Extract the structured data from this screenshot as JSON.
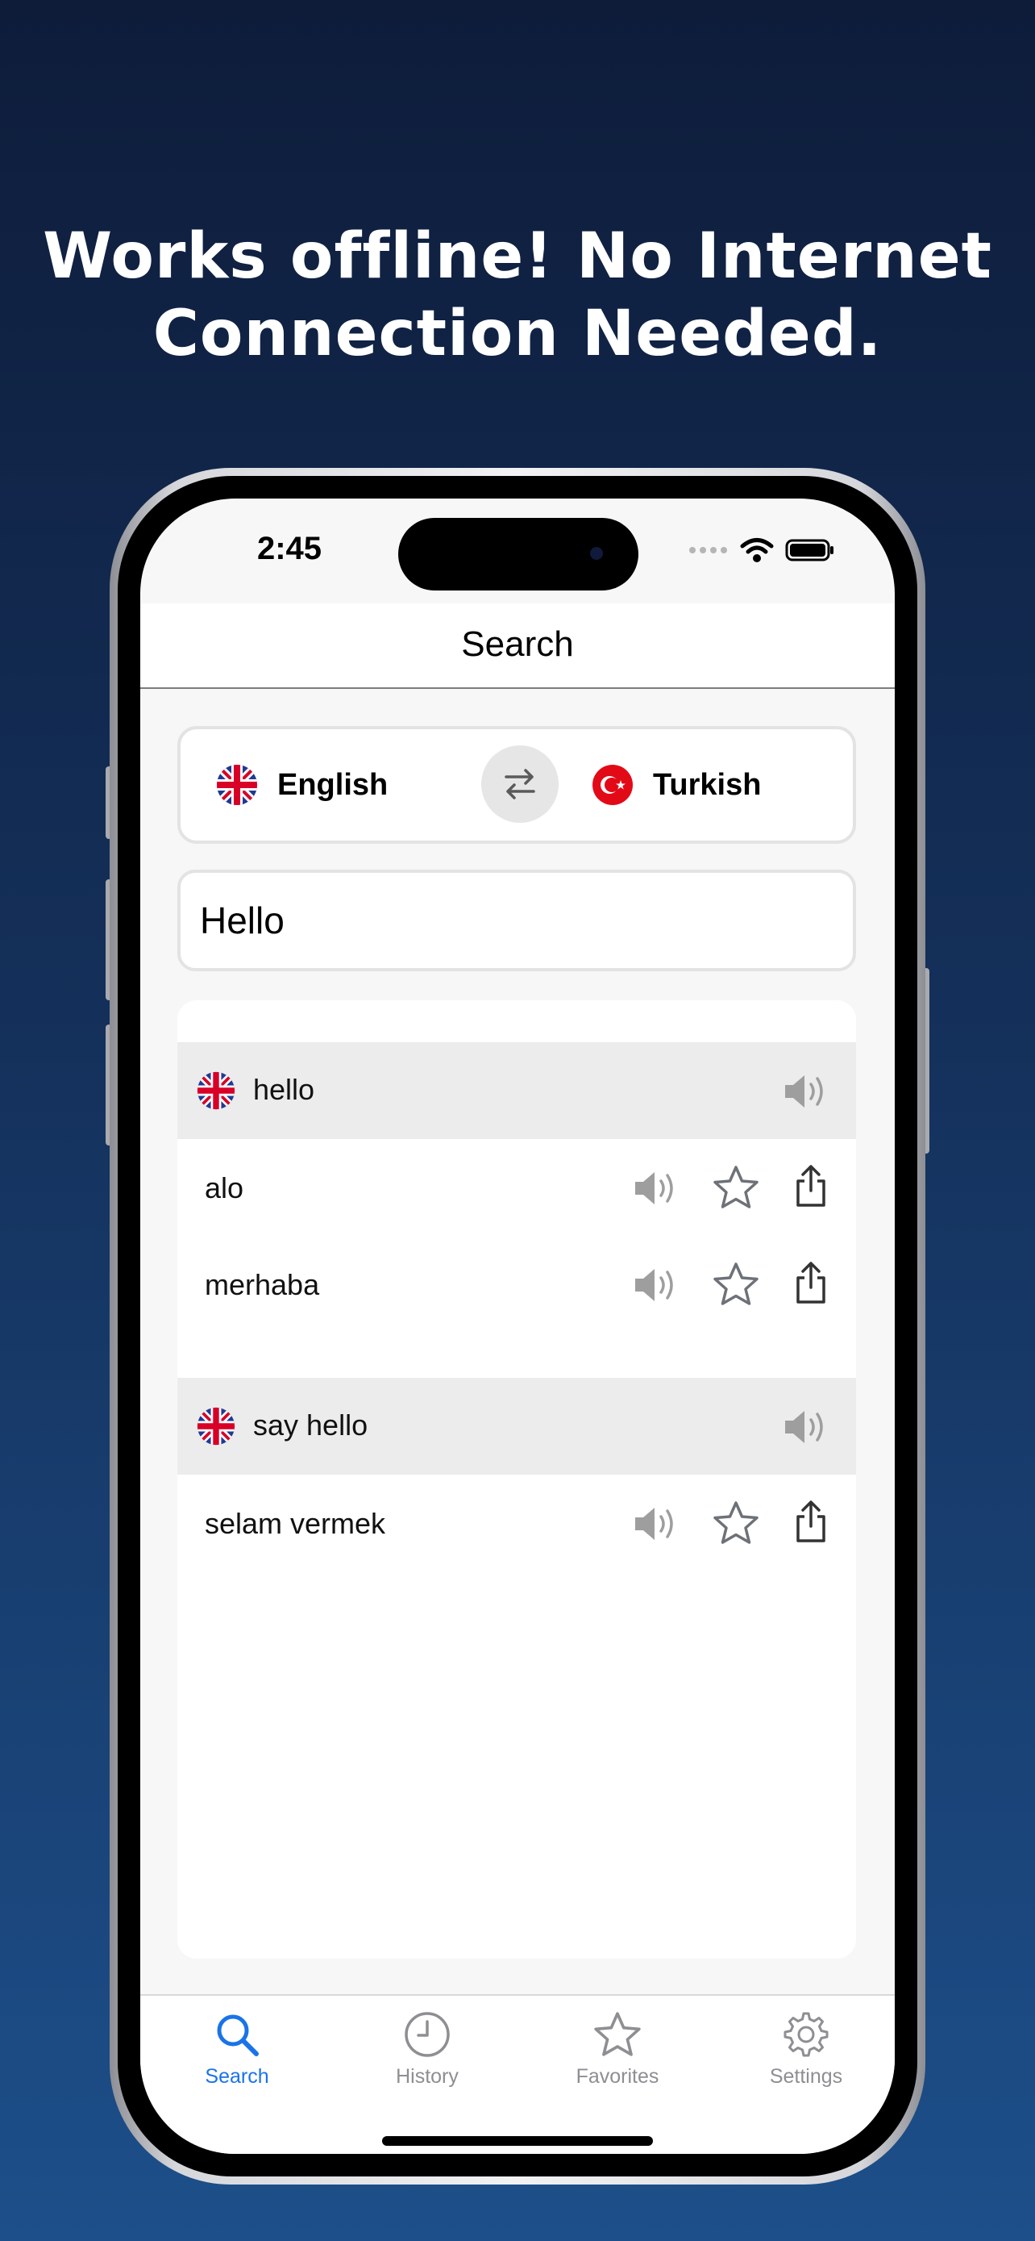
{
  "headline": {
    "line1": "Works offline! No Internet",
    "line2": "Connection Needed."
  },
  "status_bar": {
    "time": "2:45"
  },
  "nav": {
    "title": "Search"
  },
  "languages": {
    "source": {
      "label": "English",
      "flag_icon": "uk-flag-icon"
    },
    "target": {
      "label": "Turkish",
      "flag_icon": "turkey-flag-icon"
    },
    "swap_icon": "swap-arrows-icon"
  },
  "search": {
    "value": "Hello"
  },
  "results": [
    {
      "term": "hello",
      "translations": [
        "alo",
        "merhaba"
      ]
    },
    {
      "term": "say hello",
      "translations": [
        "selam vermek"
      ]
    }
  ],
  "tabs": [
    {
      "label": "Search",
      "icon": "search-icon",
      "active": true
    },
    {
      "label": "History",
      "icon": "clock-icon",
      "active": false
    },
    {
      "label": "Favorites",
      "icon": "star-icon",
      "active": false
    },
    {
      "label": "Settings",
      "icon": "gear-icon",
      "active": false
    }
  ],
  "colors": {
    "accent": "#1a73e8",
    "background_top": "#0e1c3a",
    "background_bottom": "#1d4f8a",
    "icon_gray": "#8e8e93"
  }
}
